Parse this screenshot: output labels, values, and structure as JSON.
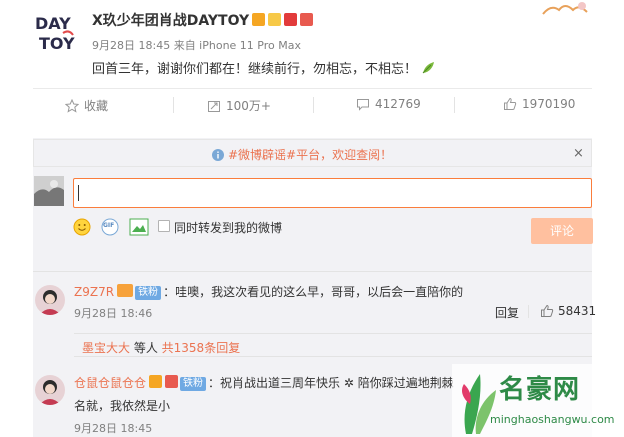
{
  "post": {
    "author": "X玖少年团肖战DAYTOY",
    "avatar_text": [
      "DAY",
      "TOY"
    ],
    "meta": "9月28日 18:45 来自 iPhone 11 Pro Max",
    "text": "回首三年，谢谢你们都在！继续前行，勿相忘，不相忘！"
  },
  "actions": {
    "favorite": "收藏",
    "repost": "100万+",
    "comments": "412769",
    "likes": "1970190"
  },
  "notice": {
    "text": "#微博辟谣#平台，欢迎查阅！",
    "close": "×"
  },
  "composer": {
    "repost_label": "同时转发到我的微博",
    "submit": "评论",
    "gif_label": "GIF"
  },
  "comments": [
    {
      "name": "Z9Z7R",
      "tag": "铁粉",
      "text": "：哇噢，我这次看见的这么早，哥哥，以后会一直陪你的",
      "time": "9月28日 18:46",
      "reply": "回复",
      "likes": "58431",
      "subreply": {
        "user": "墨宝大大",
        "mid": " 等人 ",
        "count": "共1358条回复"
      }
    },
    {
      "name": "仓鼠仓鼠仓仓",
      "tag": "铁粉",
      "text": "：祝肖战出道三周年快乐",
      "text_cont": "陪你踩过遍地荆棘",
      "line2": "名就，我依然是小",
      "time": "9月28日 18:45"
    }
  ],
  "watermark": {
    "name": "名豪网",
    "url": "minghaoshangwu.com"
  },
  "colors": {
    "accent": "#eb7350",
    "input_border": "#fa7d3c",
    "button": "#ffc09f",
    "panel": "#f2f2f5"
  }
}
